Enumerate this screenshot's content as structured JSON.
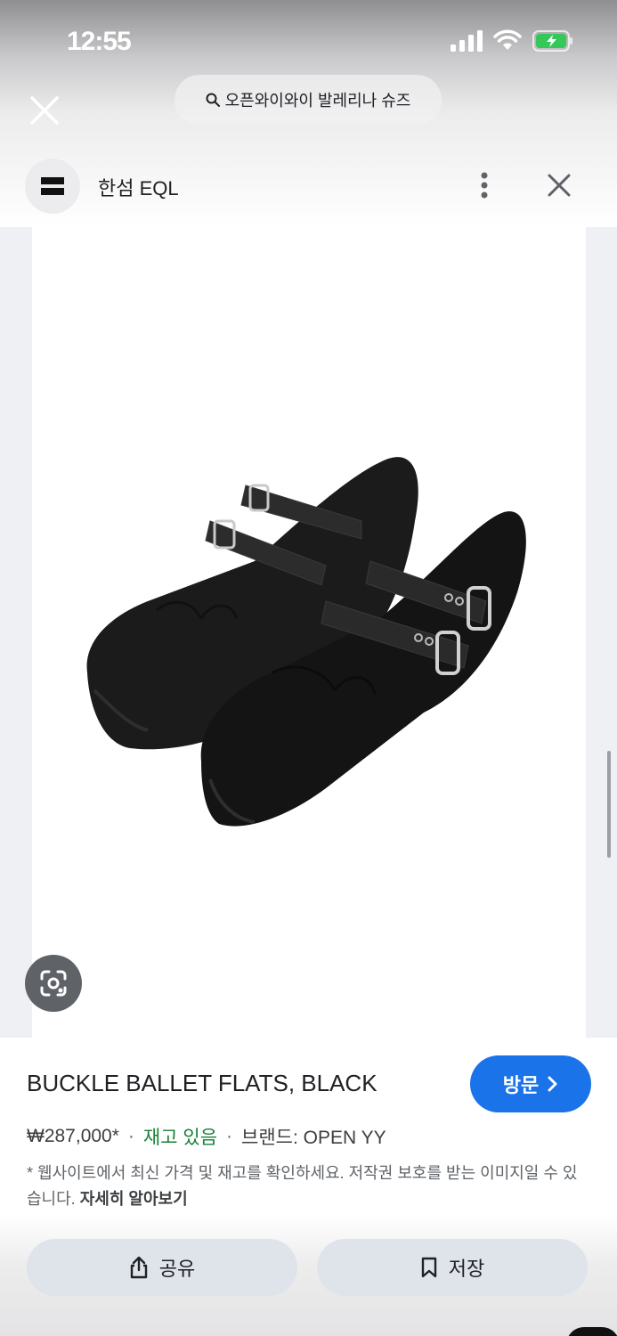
{
  "status_bar": {
    "time": "12:55"
  },
  "search": {
    "query": "오픈와이와이 발레리나 슈즈"
  },
  "source": {
    "name": "한섬 EQL"
  },
  "product": {
    "title": "BUCKLE BALLET FLATS, BLACK",
    "price": "₩287,000*",
    "stock": "재고 있음",
    "brand": "브랜드: OPEN YY",
    "disclaimer": "* 웹사이트에서 최신 가격 및 재고를 확인하세요. 저작권 보호를 받는 이미지일 수 있습니다.",
    "learn_more": "자세히 알아보기"
  },
  "buttons": {
    "visit": "방문",
    "share": "공유",
    "save": "저장"
  },
  "icons": {
    "close": "close-icon",
    "search": "search-icon",
    "more": "more-vert-icon",
    "lens": "lens-icon",
    "share": "share-icon",
    "save": "bookmark-icon",
    "chevron": "chevron-right-icon"
  },
  "colors": {
    "accent": "#1a73e8",
    "stock": "#188038"
  }
}
